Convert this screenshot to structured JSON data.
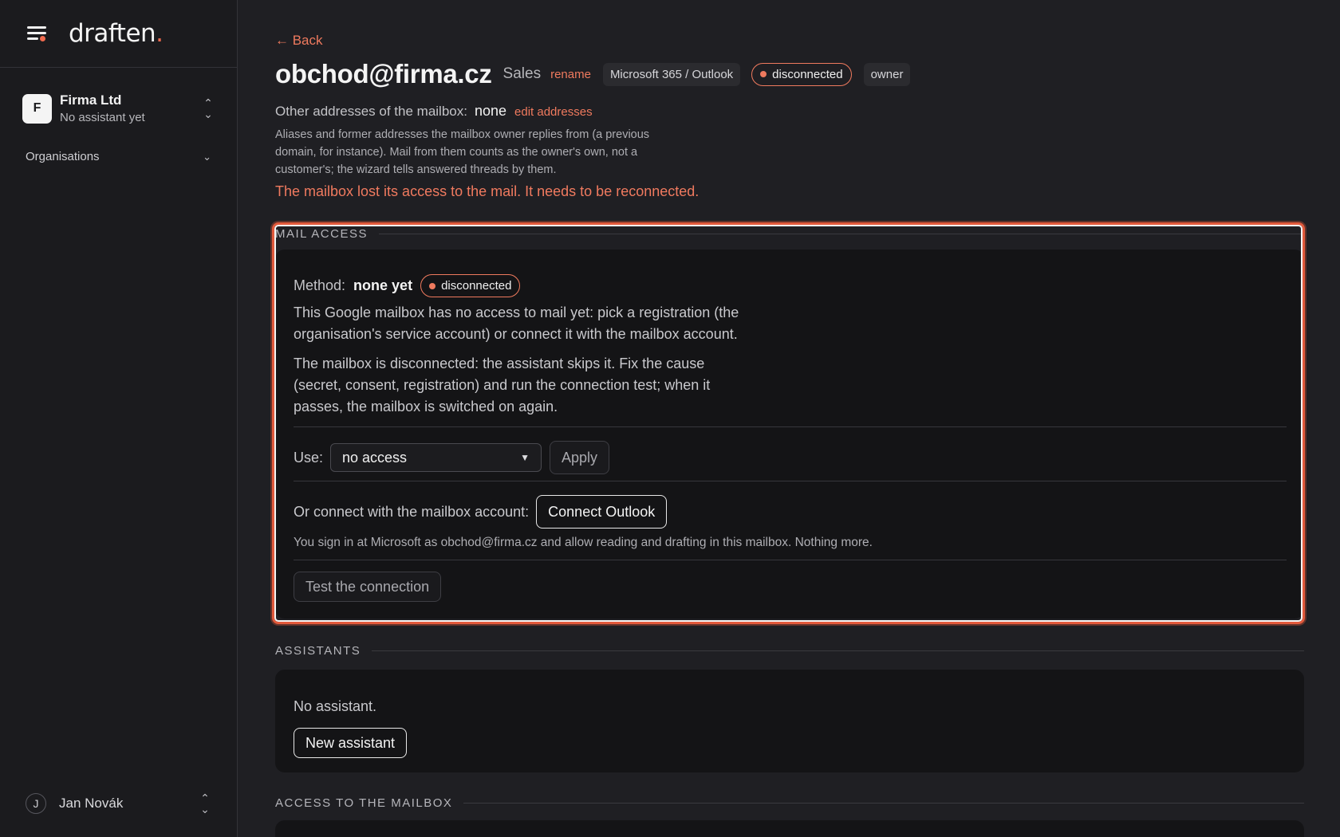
{
  "sidebar": {
    "logo": "draften",
    "logo_dot": ".",
    "org": {
      "initial": "F",
      "name": "Firma Ltd",
      "subtitle": "No assistant yet"
    },
    "nav_section": "Organisations",
    "user": {
      "initial": "J",
      "name": "Jan Novák"
    }
  },
  "header": {
    "back_label": "← Back",
    "title": "obchod@firma.cz",
    "label": "Sales",
    "rename_label": "rename",
    "provider_chip": "Microsoft 365 / Outlook",
    "status": "disconnected",
    "role_chip": "owner"
  },
  "addresses": {
    "label": "Other addresses of the mailbox:",
    "value": "none",
    "edit_label": "edit addresses",
    "help": "Aliases and former addresses the mailbox owner replies from (a previous domain, for instance). Mail from them counts as the owner's own, not a customer's; the wizard tells answered threads by them."
  },
  "error_message": "The mailbox lost its access to the mail. It needs to be reconnected.",
  "mail_access": {
    "section_title": "MAIL ACCESS",
    "method_label": "Method:",
    "method_value": "none yet",
    "status": "disconnected",
    "para1": "This Google mailbox has no access to mail yet: pick a registration (the organisation's service account) or connect it with the mailbox account.",
    "para2": "The mailbox is disconnected: the assistant skips it. Fix the cause (secret, consent, registration) and run the connection test; when it passes, the mailbox is switched on again.",
    "use_label": "Use:",
    "use_selected": "no access",
    "apply_label": "Apply",
    "connect_label": "Or connect with the mailbox account:",
    "connect_button": "Connect Outlook",
    "connect_help": "You sign in at Microsoft as obchod@firma.cz and allow reading and drafting in this mailbox. Nothing more.",
    "test_button": "Test the connection"
  },
  "assistants": {
    "section_title": "ASSISTANTS",
    "empty_text": "No assistant.",
    "new_button": "New assistant"
  },
  "mailbox_access": {
    "section_title": "ACCESS TO THE MAILBOX"
  },
  "colors": {
    "accent": "#ef7a5e",
    "highlight_frame": "#e25a3c",
    "background": "#1f1f23",
    "card": "#141416"
  }
}
